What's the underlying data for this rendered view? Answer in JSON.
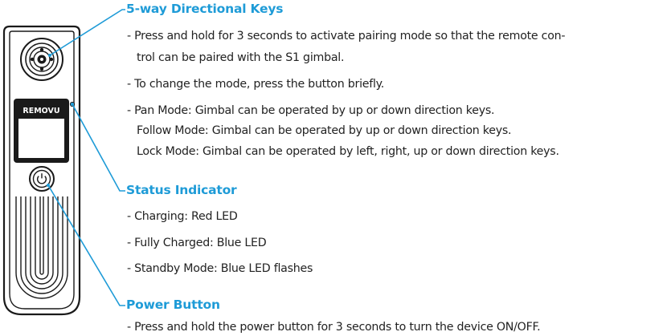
{
  "colors": {
    "accent": "#1e9bd7",
    "text": "#222222",
    "device_outline": "#1a1a1a"
  },
  "device": {
    "brand_label": "REMOVU",
    "icons": [
      "joystick-icon",
      "power-icon",
      "status-led-icon"
    ]
  },
  "sections": {
    "directional_keys": {
      "title": "5-way Directional Keys",
      "lines": [
        "- Press and hold for 3 seconds to activate pairing mode so that the remote con-",
        "trol can be paired with the S1 gimbal.",
        "- To change the mode, press the button briefly.",
        "- Pan Mode: Gimbal can be operated by up or down direction keys.",
        "Follow Mode: Gimbal can be operated by up or down direction keys.",
        "Lock Mode: Gimbal can be operated by left, right, up or down direction keys."
      ]
    },
    "status_indicator": {
      "title": "Status Indicator",
      "lines": [
        "- Charging: Red LED",
        "- Fully Charged: Blue LED",
        "- Standby Mode: Blue LED flashes"
      ]
    },
    "power_button": {
      "title": "Power Button",
      "lines": [
        "- Press and hold the power button for 3 seconds to turn the device ON/OFF."
      ]
    }
  }
}
